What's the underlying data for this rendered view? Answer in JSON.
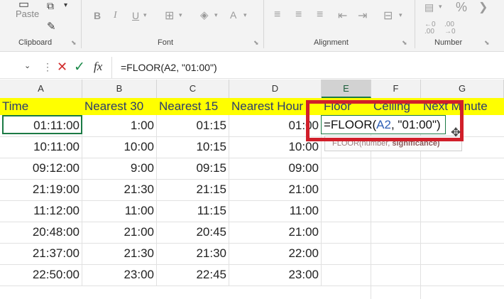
{
  "ribbon": {
    "clipboard": {
      "paste_label": "Paste",
      "group_label": "Clipboard"
    },
    "font": {
      "group_label": "Font"
    },
    "alignment": {
      "group_label": "Alignment"
    },
    "number": {
      "group_label": "Number",
      "percent_symbol": "%"
    }
  },
  "formula_bar": {
    "cancel_icon": "✕",
    "enter_icon": "✓",
    "fx_label": "fx",
    "formula": "=FLOOR(A2, \"01:00\")"
  },
  "columns": [
    "A",
    "B",
    "C",
    "D",
    "E",
    "F",
    "G"
  ],
  "headers": [
    "Time",
    "Nearest 30",
    "Nearest 15",
    "Nearest Hour",
    "Floor",
    "Ceiling",
    "Next Minute"
  ],
  "rows": [
    [
      "01:11:00",
      "1:00",
      "01:15",
      "01:00"
    ],
    [
      "10:11:00",
      "10:00",
      "10:15",
      "10:00"
    ],
    [
      "09:12:00",
      "9:00",
      "09:15",
      "09:00"
    ],
    [
      "21:19:00",
      "21:30",
      "21:15",
      "21:00"
    ],
    [
      "11:12:00",
      "11:00",
      "11:15",
      "11:00"
    ],
    [
      "20:48:00",
      "21:00",
      "20:45",
      "21:00"
    ],
    [
      "21:37:00",
      "21:30",
      "21:30",
      "22:00"
    ],
    [
      "22:50:00",
      "23:00",
      "22:45",
      "23:00"
    ]
  ],
  "edit": {
    "prefix": "=FLOOR(",
    "ref": "A2",
    "suffix": ", \"01:00\")",
    "tooltip_func": "FLOOR(number, ",
    "tooltip_arg": "significance)",
    "ref_color": "#2e5fb5"
  },
  "colors": {
    "accent": "#1b7a45",
    "highlight": "#ffff00",
    "annotation": "#d11f2a"
  }
}
